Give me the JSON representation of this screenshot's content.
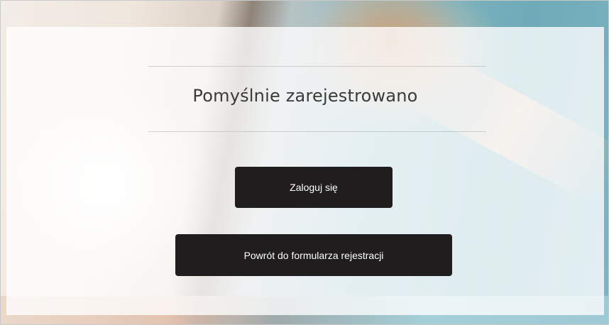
{
  "page": {
    "title": "Pomyślnie zarejestrowano"
  },
  "buttons": {
    "login_label": "Zaloguj się",
    "back_label": "Powrót do formularza rejestracji"
  },
  "colors": {
    "button_bg": "#1f1d1d",
    "button_text": "#ffffff",
    "title_text": "#3a3a3a"
  }
}
